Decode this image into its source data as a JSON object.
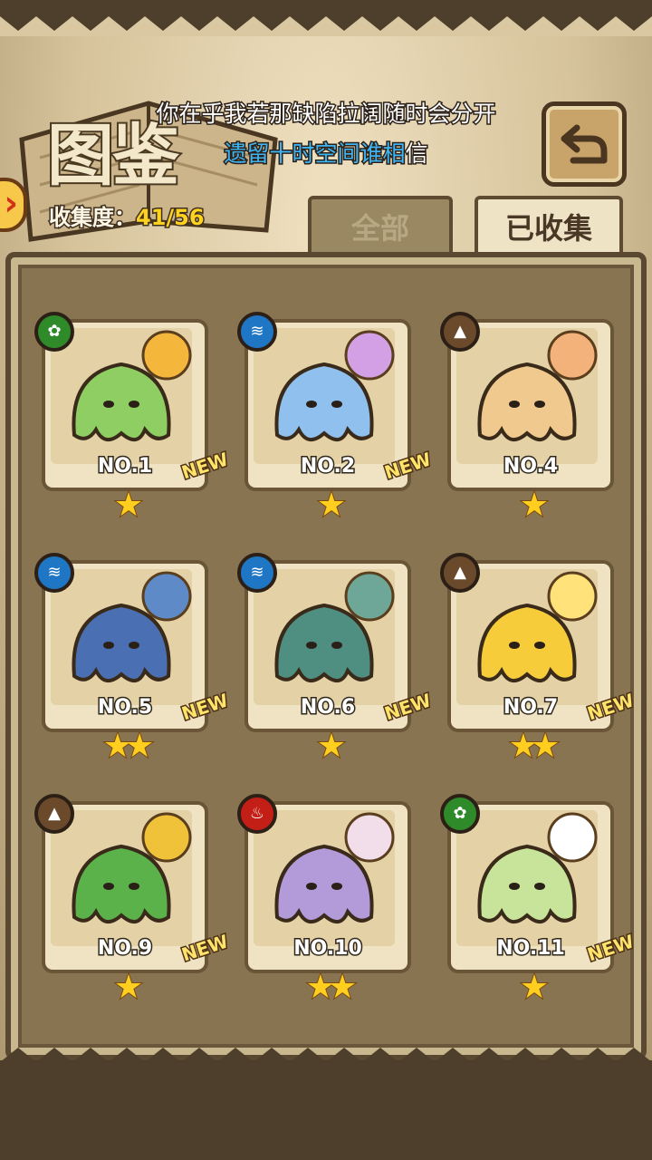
{
  "header": {
    "title": "图鉴",
    "progress_label": "收集度：",
    "progress_value": "41/56"
  },
  "lyrics": {
    "line1": "你在乎我若那缺陷拉阔随时会分开",
    "line2_highlight": "遗留十时空间谁相",
    "line2_rest": "信"
  },
  "tabs": {
    "all": "全部",
    "collected": "已收集"
  },
  "colors": {
    "leaf": "#2f8a2a",
    "water": "#1f76c4",
    "earth": "#6b4a2c",
    "fire": "#c41f16",
    "star": "#ffce1f"
  },
  "cards": [
    {
      "number": "NO.1",
      "element_icon": "leaf-icon",
      "stars": "★",
      "new": "NEW",
      "body": "#8fce63",
      "accent": "#f5b63c"
    },
    {
      "number": "NO.2",
      "element_icon": "water-icon",
      "stars": "★",
      "new": "NEW",
      "body": "#8fc0ee",
      "accent": "#d3a0e6"
    },
    {
      "number": "NO.4",
      "element_icon": "mountain-icon",
      "stars": "★",
      "new": "",
      "body": "#f0c98e",
      "accent": "#f2b27a"
    },
    {
      "number": "NO.5",
      "element_icon": "water-icon",
      "stars": "★★",
      "new": "NEW",
      "body": "#4a70b3",
      "accent": "#5e8ac8"
    },
    {
      "number": "NO.6",
      "element_icon": "water-icon",
      "stars": "★",
      "new": "NEW",
      "body": "#4f8f82",
      "accent": "#6ea797"
    },
    {
      "number": "NO.7",
      "element_icon": "mountain-icon",
      "stars": "★★",
      "new": "NEW",
      "body": "#f6cc3a",
      "accent": "#ffe27a"
    },
    {
      "number": "NO.9",
      "element_icon": "mountain-icon",
      "stars": "★",
      "new": "NEW",
      "body": "#5bb24b",
      "accent": "#f0c23a"
    },
    {
      "number": "NO.10",
      "element_icon": "fire-icon",
      "stars": "★★",
      "new": "",
      "body": "#b39ad9",
      "accent": "#f2ddea"
    },
    {
      "number": "NO.11",
      "element_icon": "leaf-icon",
      "stars": "★",
      "new": "NEW",
      "body": "#c8e49a",
      "accent": "#ffffff"
    }
  ]
}
